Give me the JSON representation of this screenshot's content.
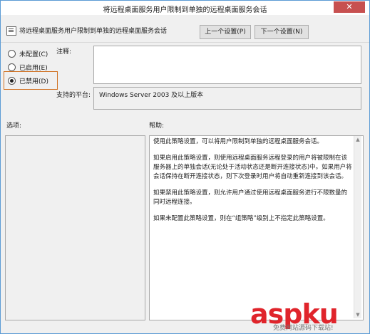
{
  "window": {
    "title": "将远程桌面服务用户限制到单独的远程桌面服务会话",
    "close_glyph": "✕"
  },
  "header": {
    "policy_name": "将远程桌面服务用户限制到单独的远程桌面服务会话"
  },
  "nav": {
    "prev_label": "上一个设置(P)",
    "next_label": "下一个设置(N)"
  },
  "state": {
    "options": [
      {
        "label": "未配置(C)",
        "selected": false
      },
      {
        "label": "已启用(E)",
        "selected": false
      },
      {
        "label": "已禁用(D)",
        "selected": true
      }
    ]
  },
  "comment": {
    "label": "注释:",
    "value": ""
  },
  "platform": {
    "label": "支持的平台:",
    "value": "Windows Server 2003 及以上版本"
  },
  "options_section": {
    "label": "选项:"
  },
  "help_section": {
    "label": "帮助:",
    "paragraphs": [
      "使用此策略设置，可以将用户限制到单独的远程桌面服务会话。",
      "如果启用此策略设置，则使用远程桌面服务远程登录的用户将被限制在该服务器上的单独会话(无论处于活动状态还是断开连接状态)中。如果用户将会话保持在断开连接状态，则下次登录时用户将自动重新连接到该会话。",
      "如果禁用此策略设置，则允许用户通过使用远程桌面服务进行不限数量的同时远程连接。",
      "如果未配置此策略设置，则在“组策略”级别上不指定此策略设置。"
    ]
  },
  "watermark": {
    "brand": "aspku",
    "sub": "免费网站源码下载站!"
  }
}
